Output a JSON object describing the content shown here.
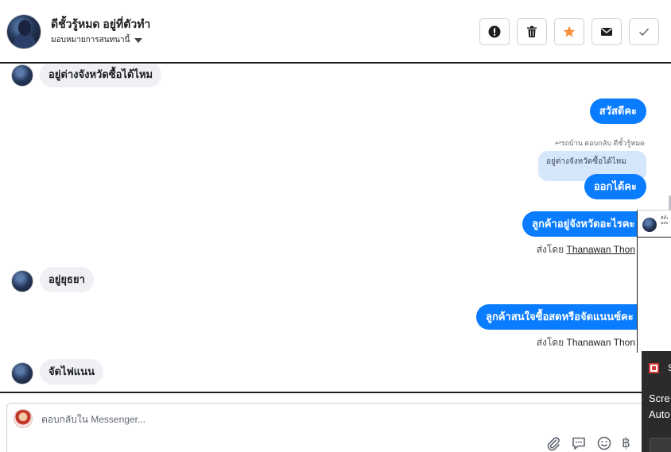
{
  "header": {
    "contact_name": "ดีชั้วรู้หมด อยู่ที่ตัวทำ",
    "assign_label": "มอบหมายการสนทนานี้",
    "action_icons": [
      "alert-icon",
      "trash-icon",
      "star-icon",
      "mail-icon",
      "check-icon"
    ],
    "star_color": "#f7923b"
  },
  "messages": [
    {
      "dir": "in",
      "text": "อยู่ต่างจังหวัดซื้อได้ไหม"
    },
    {
      "dir": "out",
      "text": "สวัสดีคะ"
    },
    {
      "dir": "out",
      "reply_meta": "↩รถบ้าน ตอบกลับ ดีชั้วรู้หมด",
      "reply_quote": "อยู่ต่างจังหวัดซื้อได้ไหม",
      "text": "ออกได้คะ"
    },
    {
      "dir": "out",
      "text": "ลูกค้าอยู่จังหวัดอะไรคะ",
      "sent_by_prefix": "ส่งโดย",
      "sent_by_name": "Thanawan Thon"
    },
    {
      "dir": "in",
      "text": "อยู่ยุธยา"
    },
    {
      "dir": "out",
      "text": "ลูกค้าสนใจซื้อสดหรือจัดแนนซ์คะ",
      "sent_by_prefix": "ส่งโดย",
      "sent_by_name": "Thanawan Thon"
    },
    {
      "dir": "in",
      "text": "จัดไฟแนน"
    }
  ],
  "composer": {
    "placeholder": "ตอบกลับใน Messenger...",
    "tool_icons": [
      "paperclip-icon",
      "chat-bubble-icon",
      "emoji-icon",
      "baht-icon"
    ],
    "baht_symbol": "฿"
  },
  "toast": {
    "title": "S",
    "line1": "Scre",
    "line2": "Auto"
  },
  "colors": {
    "accent": "#0a7cff",
    "incoming_bubble": "#eef0f3",
    "quote_bg": "#d6e6fb"
  }
}
